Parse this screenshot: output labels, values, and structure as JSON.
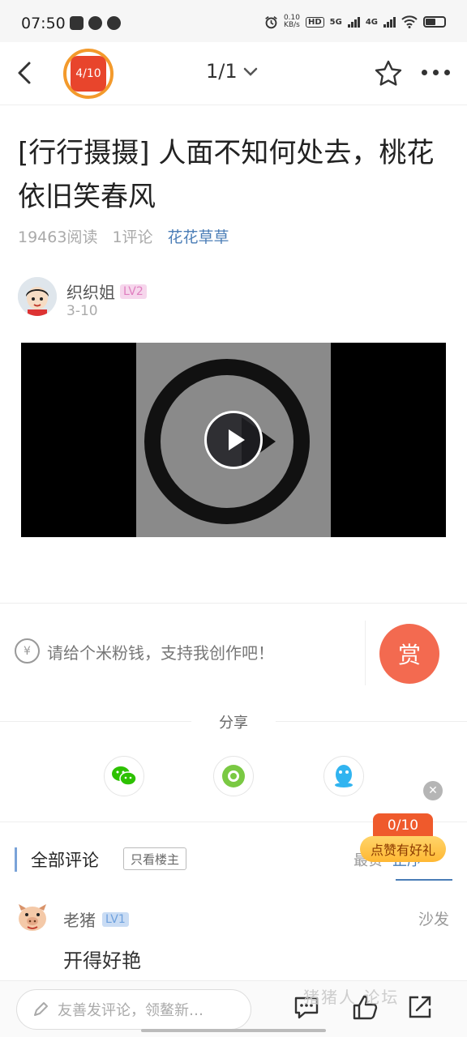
{
  "status_bar": {
    "time": "07:50",
    "net_speed_value": "0.10",
    "net_speed_unit": "KB/s",
    "hd_tag": "HD",
    "net1": "5G",
    "net2": "4G"
  },
  "nav": {
    "progress_badge": "4/10",
    "page_indicator": "1/1"
  },
  "post": {
    "title": "[行行摄摄] 人面不知何处去，桃花依旧笑春风",
    "reads": "19463阅读",
    "comments": "1评论",
    "forum": "花花草草"
  },
  "author": {
    "name": "织织姐",
    "level": "LV2",
    "date": "3-10"
  },
  "tip": {
    "icon_symbol": "¥",
    "text": "请给个米粉钱，支持我创作吧！",
    "reward_label": "赏"
  },
  "share": {
    "label": "分享",
    "targets": [
      "wechat-icon",
      "moments-icon",
      "qq-icon"
    ]
  },
  "like_promo": {
    "count": "0/10",
    "label": "点赞有好礼"
  },
  "comments": {
    "header": "全部评论",
    "only_op": "只看楼主",
    "sort_options": [
      "最赞",
      "正序"
    ],
    "items": [
      {
        "user": "老猪",
        "level": "LV1",
        "floor": "沙发",
        "text": "开得好艳"
      }
    ]
  },
  "bottom_bar": {
    "comment_placeholder": "友善发评论，领鳌新…",
    "watermark": "猪猪人 论坛"
  },
  "colors": {
    "accent_red": "#e8452c",
    "reward_orange": "#f36a50",
    "link_blue": "#4a7db6",
    "promo_yellow": "#ffc84a"
  }
}
